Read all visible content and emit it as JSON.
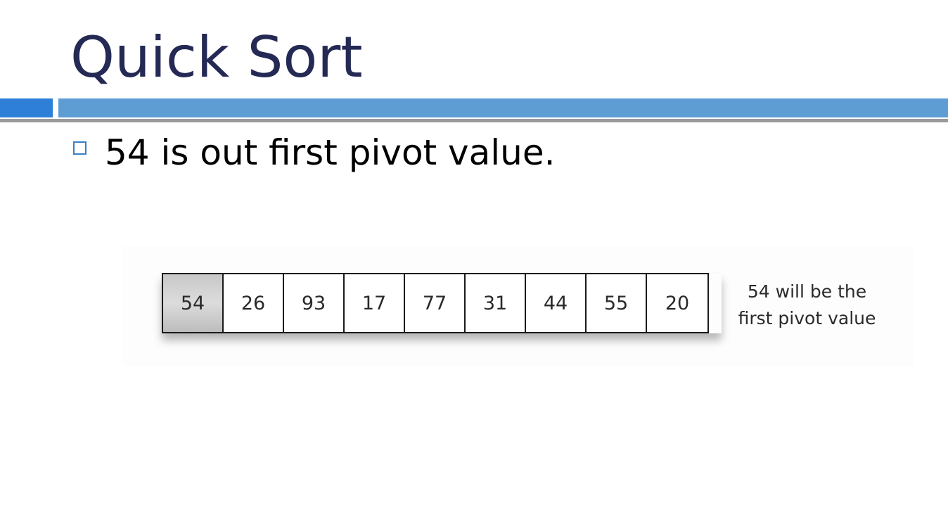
{
  "slide": {
    "title": "Quick Sort",
    "bullet": "54 is out first pivot value."
  },
  "figure": {
    "cells": [
      "54",
      "26",
      "93",
      "17",
      "77",
      "31",
      "44",
      "55",
      "20"
    ],
    "pivot_index": 0,
    "caption_line1": "54 will be the",
    "caption_line2": "first pivot value"
  },
  "colors": {
    "title": "#242a54",
    "accent_dark_blue": "#2e7fd8",
    "accent_light_blue": "#5d9dd4",
    "rule_gray": "#9a9a9a",
    "pivot_cell": "#d0d0d0"
  }
}
